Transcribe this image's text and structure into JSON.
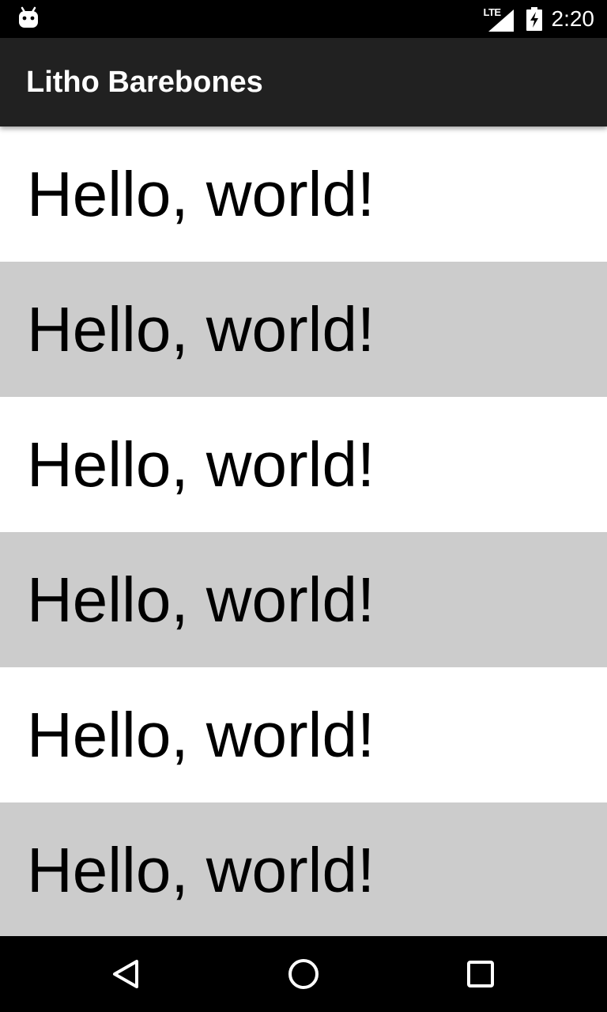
{
  "status_bar": {
    "network_label": "LTE",
    "time": "2:20",
    "icons": [
      "android-notification-icon",
      "lte-signal-icon",
      "battery-charging-icon"
    ]
  },
  "app_bar": {
    "title": "Litho Barebones",
    "background": "#212121"
  },
  "list": {
    "items": [
      {
        "text": "Hello, world!"
      },
      {
        "text": "Hello, world!"
      },
      {
        "text": "Hello, world!"
      },
      {
        "text": "Hello, world!"
      },
      {
        "text": "Hello, world!"
      },
      {
        "text": "Hello, world!"
      }
    ],
    "colors": {
      "odd_row": "#ffffff",
      "even_row": "#cccccc"
    }
  },
  "nav_bar": {
    "buttons": [
      "back",
      "home",
      "recents"
    ]
  }
}
